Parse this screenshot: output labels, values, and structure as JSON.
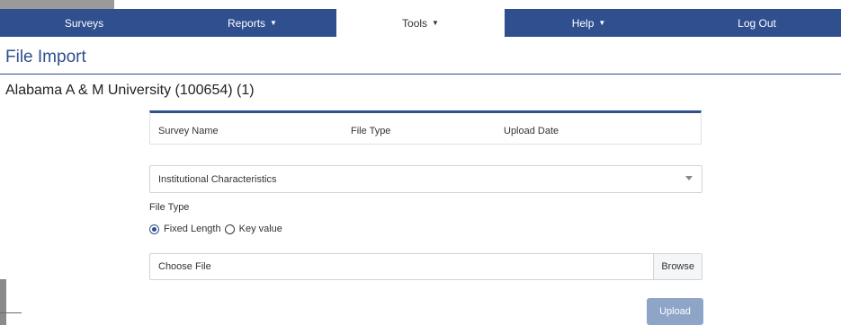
{
  "nav": {
    "items": [
      {
        "label": "Surveys",
        "caret": false,
        "active": false
      },
      {
        "label": "Reports",
        "caret": true,
        "active": false
      },
      {
        "label": "Tools",
        "caret": true,
        "active": true
      },
      {
        "label": "Help",
        "caret": true,
        "active": false
      },
      {
        "label": "Log Out",
        "caret": false,
        "active": false
      }
    ]
  },
  "page": {
    "title": "File Import",
    "institution": "Alabama A & M University (100654) (1)"
  },
  "table": {
    "headers": [
      "Survey Name",
      "File Type",
      "Upload Date"
    ]
  },
  "survey_select": {
    "value": "Institutional Characteristics"
  },
  "file_type": {
    "label": "File Type",
    "options": [
      {
        "label": "Fixed Length",
        "checked": true
      },
      {
        "label": "Key value",
        "checked": false
      }
    ]
  },
  "file_input": {
    "placeholder": "Choose File",
    "browse_label": "Browse"
  },
  "upload": {
    "label": "Upload"
  },
  "colors": {
    "nav_bg": "#2f4f8f",
    "upload_bg": "#8ea5c8"
  }
}
